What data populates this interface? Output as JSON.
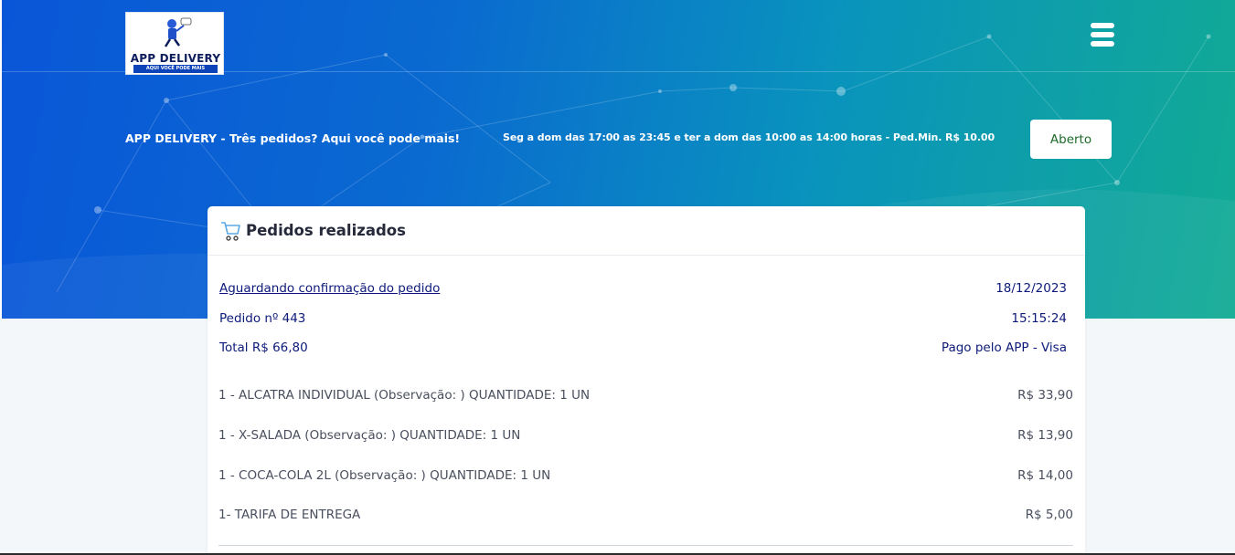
{
  "brand": {
    "logo_name": "APP DELIVERY",
    "logo_tagline": "AQUI VOCÊ PODE MAIS"
  },
  "header": {
    "slogan": "APP DELIVERY - Três pedidos? Aqui você pode mais!",
    "hours": "Seg a dom das 17:00 as 23:45 e ter a dom das 10:00 as 14:00 horas - Ped.Min. R$ 10.00",
    "status_label": "Aberto"
  },
  "orders": {
    "title": "Pedidos realizados",
    "order": {
      "status_link": "Aguardando confirmação do pedido",
      "date": "18/12/2023",
      "number_label": "Pedido nº 443",
      "time": "15:15:24",
      "total_label": "Total R$ 66,80",
      "payment": "Pago pelo APP - Visa",
      "items": [
        {
          "description": "1 - ALCATRA INDIVIDUAL (Observação: ) QUANTIDADE: 1 UN",
          "price": "R$ 33,90"
        },
        {
          "description": "1 - X-SALADA (Observação: ) QUANTIDADE: 1 UN",
          "price": "R$ 13,90"
        },
        {
          "description": "1 - COCA-COLA 2L (Observação: ) QUANTIDADE: 1 UN",
          "price": "R$ 14,00"
        },
        {
          "description": "1- TARIFA DE ENTREGA",
          "price": "R$ 5,00"
        }
      ]
    }
  },
  "colors": {
    "hero_start": "#0a56d8",
    "hero_end": "#12ab94",
    "text_navy": "#0d1a7a",
    "status_green": "#1d6b2a"
  },
  "icons": [
    "hamburger-menu-icon",
    "shopping-cart-icon"
  ]
}
